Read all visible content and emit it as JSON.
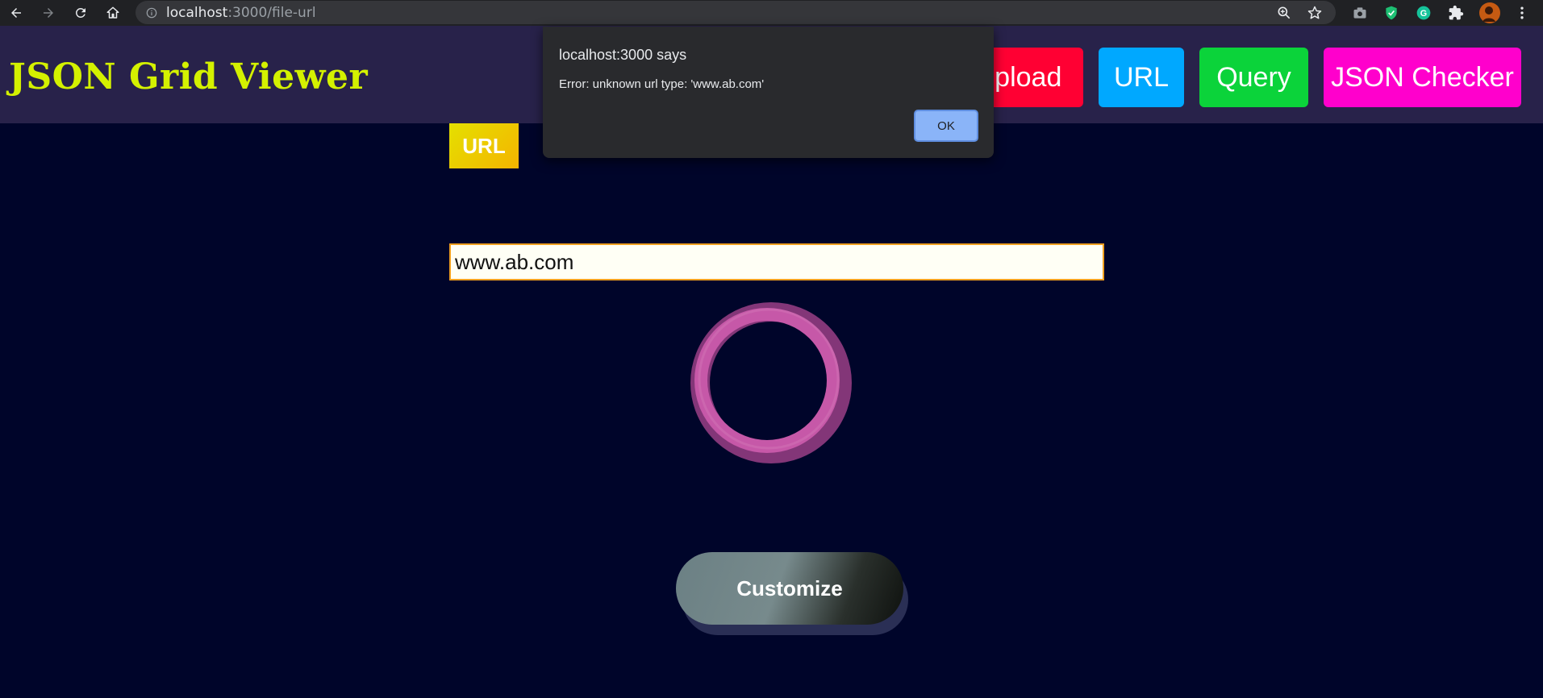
{
  "browser": {
    "url_host": "localhost",
    "url_path": ":3000/file-url"
  },
  "app": {
    "title": "JSON Grid Viewer",
    "nav": [
      {
        "label": "Upload",
        "color": "#ff0033"
      },
      {
        "label": "URL",
        "color": "#00a8ff"
      },
      {
        "label": "Query",
        "color": "#0bd33a"
      },
      {
        "label": "JSON Checker",
        "color": "#ff00cc"
      }
    ]
  },
  "main": {
    "badge": "URL",
    "url_input_value": "www.ab.com",
    "spinner_color": "#c658a8",
    "customize_label": "Customize"
  },
  "dialog": {
    "title": "localhost:3000 says",
    "message": "Error: unknown url type: 'www.ab.com'",
    "ok_label": "OK"
  }
}
